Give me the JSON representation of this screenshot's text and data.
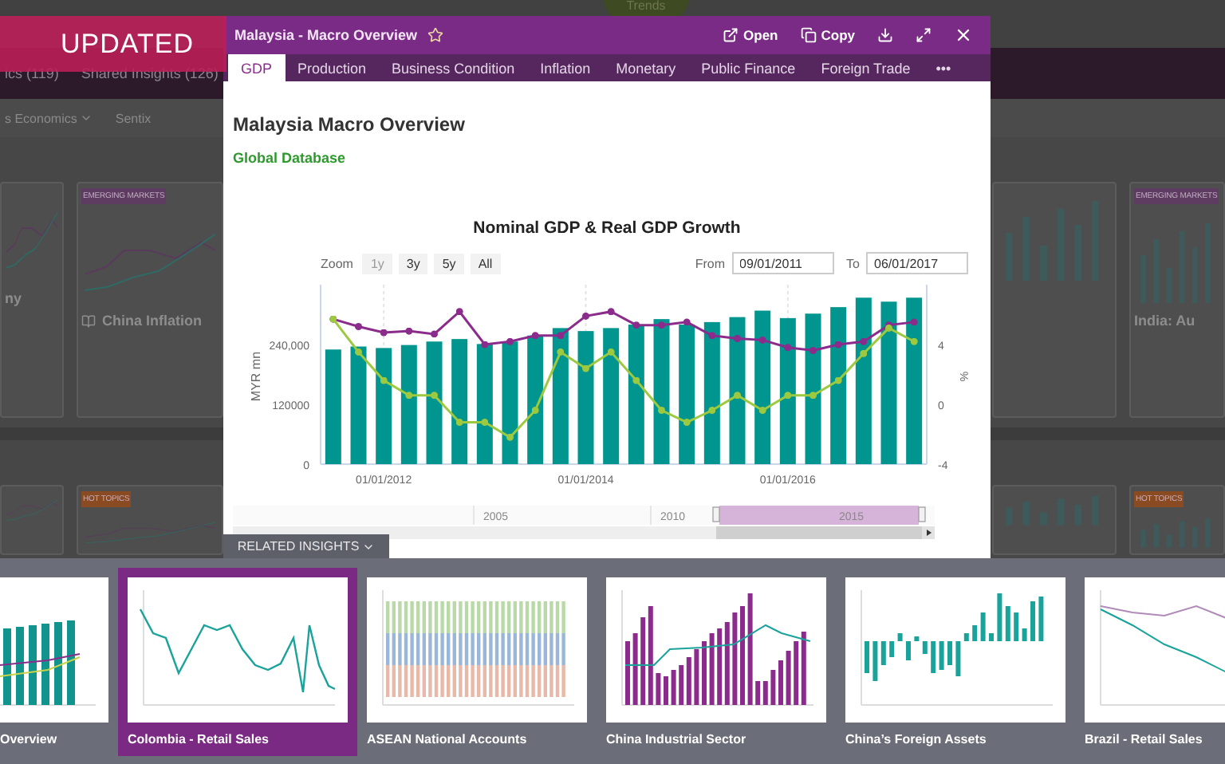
{
  "background": {
    "badge": "Trends",
    "nav_tabs": [
      "ics (119)",
      "Shared Insights (126)"
    ],
    "filters": [
      {
        "label": "s Economics",
        "dropdown": true
      },
      {
        "label": "Sentix",
        "dropdown": false
      }
    ],
    "card_rows": [
      [
        {
          "title": "ny"
        },
        {
          "tag": "EMERGING MARKETS",
          "color": "#5e3b60",
          "title": "China Inflation"
        },
        {},
        {
          "tag": "EMERGING MARKETS",
          "color": "#5e3b60",
          "title": "India: Au"
        }
      ],
      [
        {},
        {
          "tag": "HOT TOPICS",
          "color": "#8a4a22"
        },
        {},
        {
          "tag": "HOT TOPICS",
          "color": "#8a4a22"
        }
      ]
    ]
  },
  "ribbon": "UPDATED",
  "modal": {
    "title": "Malaysia - Macro Overview",
    "starred": false,
    "actions": [
      {
        "kind": "open",
        "label": "Open"
      },
      {
        "kind": "copy",
        "label": "Copy"
      },
      {
        "kind": "download"
      },
      {
        "kind": "expand"
      },
      {
        "kind": "close"
      }
    ],
    "tabs": [
      {
        "label": "GDP",
        "selected": true
      },
      {
        "label": "Production",
        "selected": false
      },
      {
        "label": "Business Condition",
        "selected": false
      },
      {
        "label": "Inflation",
        "selected": false
      },
      {
        "label": "Monetary",
        "selected": false
      },
      {
        "label": "Public Finance",
        "selected": false
      },
      {
        "label": "Foreign Trade",
        "selected": false
      },
      {
        "label": "•••",
        "selected": false
      }
    ],
    "heading": "Malaysia Macro Overview",
    "source": "Global Database",
    "chart": {
      "zoom_label": "Zoom",
      "zoom_buttons": [
        {
          "label": "1y",
          "disabled": true
        },
        {
          "label": "3y",
          "disabled": false
        },
        {
          "label": "5y",
          "disabled": false
        },
        {
          "label": "All",
          "disabled": false
        }
      ],
      "from_label": "From",
      "from": "09/01/2011",
      "to_label": "To",
      "to": "06/01/2017",
      "chart_data": {
        "type": "bar",
        "title": "Nominal GDP & Real GDP Growth",
        "ylabel": "MYR mn",
        "y2label": "%",
        "categories": [
          null,
          null,
          "01/01/2012",
          null,
          null,
          null,
          null,
          null,
          null,
          null,
          "01/01/2014",
          null,
          null,
          null,
          null,
          null,
          null,
          null,
          "01/01/2016",
          null,
          null,
          null,
          null,
          null
        ],
        "series": [
          {
            "type": "bar",
            "axis": "y",
            "color": "#00968f",
            "values": [
              230000,
              236000,
              233000,
              239000,
              246000,
              251000,
              241000,
              246000,
              258000,
              273000,
              267000,
              273000,
              280000,
              291000,
              280000,
              285000,
              295000,
              308000,
              293000,
              302000,
              315000,
              334000,
              326000,
              334000
            ]
          },
          {
            "type": "line",
            "axis": "y2",
            "color": "#8b2c8c",
            "values": [
              5.7,
              5.2,
              4.8,
              4.9,
              4.7,
              6.2,
              4.0,
              4.2,
              4.6,
              4.6,
              5.9,
              6.2,
              5.3,
              5.3,
              5.5,
              4.6,
              4.4,
              4.3,
              3.8,
              3.6,
              4.0,
              4.2,
              5.3,
              5.5
            ]
          },
          {
            "type": "line",
            "axis": "y2",
            "color": "#9cc93f",
            "values": [
              5.7,
              3.5,
              1.6,
              0.6,
              0.6,
              -1.2,
              -1.2,
              -2.2,
              -0.4,
              3.5,
              2.4,
              3.5,
              1.6,
              -0.4,
              -1.2,
              -0.4,
              0.6,
              -0.4,
              0.6,
              0.6,
              1.6,
              3.4,
              5.1,
              4.2
            ]
          }
        ],
        "grid": true,
        "ylim": [
          0,
          360000
        ],
        "yticks": [
          0,
          120000,
          {
            "value": 240000,
            "label": "240,000"
          }
        ],
        "y2lim": [
          -4,
          8
        ],
        "y2ticks": [
          -4,
          0,
          4
        ]
      },
      "navigator": {
        "labels": [
          "2005",
          "2010",
          "2015"
        ]
      }
    }
  },
  "related": {
    "label": "RELATED INSIGHTS",
    "insights": [
      {
        "title": "Overview",
        "kind": "bars-lines",
        "selected": false
      },
      {
        "title": "Colombia - Retail Sales",
        "kind": "line",
        "selected": true
      },
      {
        "title": "ASEAN National Accounts",
        "kind": "stacked",
        "selected": false
      },
      {
        "title": "China Industrial Sector",
        "kind": "bars-line",
        "selected": false
      },
      {
        "title": "China’s Foreign Assets",
        "kind": "diverging",
        "selected": false
      },
      {
        "title": "Brazil - Retail Sales",
        "kind": "lines",
        "selected": false
      }
    ]
  }
}
